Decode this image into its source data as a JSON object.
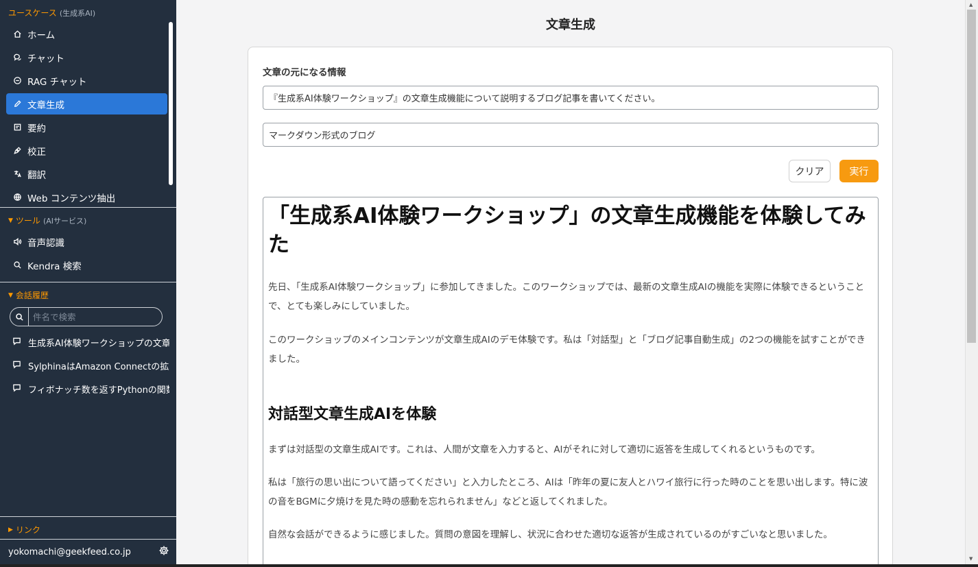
{
  "sidebar": {
    "usecase_header": "ユースケース",
    "usecase_sub": "(生成系AI)",
    "nav": [
      {
        "label": "ホーム",
        "icon": "home-icon"
      },
      {
        "label": "チャット",
        "icon": "chat-icon"
      },
      {
        "label": "RAG チャット",
        "icon": "rag-chat-icon"
      },
      {
        "label": "文章生成",
        "icon": "pencil-icon",
        "active": true
      },
      {
        "label": "要約",
        "icon": "summary-icon"
      },
      {
        "label": "校正",
        "icon": "pen-nib-icon"
      },
      {
        "label": "翻訳",
        "icon": "translate-icon"
      },
      {
        "label": "Web コンテンツ抽出",
        "icon": "globe-icon"
      }
    ],
    "tools_header": "ツール",
    "tools_sub": "(AIサービス)",
    "tools": [
      {
        "label": "音声認識",
        "icon": "speaker-icon"
      },
      {
        "label": "Kendra 検索",
        "icon": "search-icon"
      }
    ],
    "history_header": "会話履歴",
    "history_search_placeholder": "件名で検索",
    "history": [
      {
        "label": "生成系AI体験ワークショップの文章"
      },
      {
        "label": "SylphinaはAmazon Connectの拡"
      },
      {
        "label": "フィボナッチ数を返すPythonの関数"
      }
    ],
    "links_header": "リンク",
    "user_email": "yokomachi@geekfeed.co.jp"
  },
  "main": {
    "title": "文章生成",
    "section_label": "文章の元になる情報",
    "input_info": "『生成系AI体験ワークショップ』の文章生成機能について説明するブログ記事を書いてください。",
    "input_context": "マークダウン形式のブログ",
    "clear_label": "クリア",
    "run_label": "実行",
    "output": {
      "h1": "「生成系AI体験ワークショップ」の文章生成機能を体験してみた",
      "p1": "先日、「生成系AI体験ワークショップ」に参加してきました。このワークショップでは、最新の文章生成AIの機能を実際に体験できるということで、とても楽しみにしていました。",
      "p2": "このワークショップのメインコンテンツが文章生成AIのデモ体験です。私は「対話型」と「ブログ記事自動生成」の2つの機能を試すことができました。",
      "h2": "対話型文章生成AIを体験",
      "p3": "まずは対話型の文章生成AIです。これは、人間が文章を入力すると、AIがそれに対して適切に返答を生成してくれるというものです。",
      "p4": "私は「旅行の思い出について語ってください」と入力したところ、AIは「昨年の夏に友人とハワイ旅行に行った時のことを思い出します。特に波の音をBGMに夕焼けを見た時の感動を忘れられません」などと返してくれました。",
      "p5": "自然な会話ができるように感じました。質問の意図を理解し、状況に合わせた適切な返答が生成されているのがすごいなと思いました。"
    }
  },
  "colors": {
    "sidebar_bg": "#232f3e",
    "accent_orange": "#ff9900",
    "active_blue": "#2b78d8",
    "run_button": "#f79a10"
  }
}
